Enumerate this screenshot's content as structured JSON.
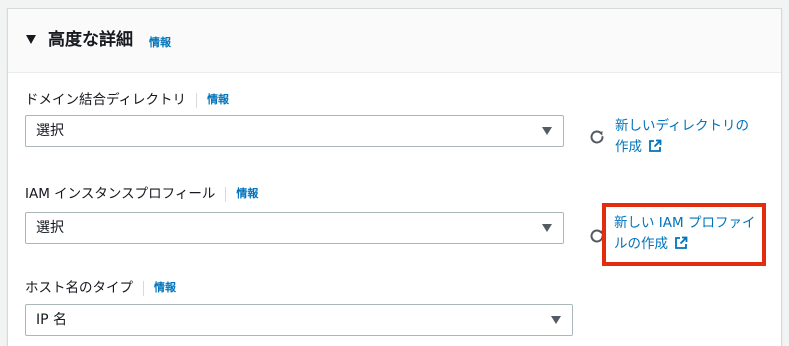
{
  "section": {
    "title": "高度な詳細",
    "info": "情報"
  },
  "fields": {
    "domain_directory": {
      "label": "ドメイン結合ディレクトリ",
      "info": "情報",
      "value": "選択",
      "create_link_line1": "新しいディレクトリの",
      "create_link_line2": "作成"
    },
    "iam_profile": {
      "label": "IAM インスタンスプロフィール",
      "info": "情報",
      "value": "選択",
      "create_link_line1": "新しい IAM プロファイ",
      "create_link_line2": "ルの作成"
    },
    "hostname_type": {
      "label": "ホスト名のタイプ",
      "info": "情報",
      "value": "IP 名"
    }
  },
  "colors": {
    "link": "#0073bb",
    "highlight": "#e22d0f"
  },
  "icons": [
    "caret-down-icon",
    "refresh-icon",
    "external-link-icon",
    "dropdown-arrow-icon"
  ]
}
